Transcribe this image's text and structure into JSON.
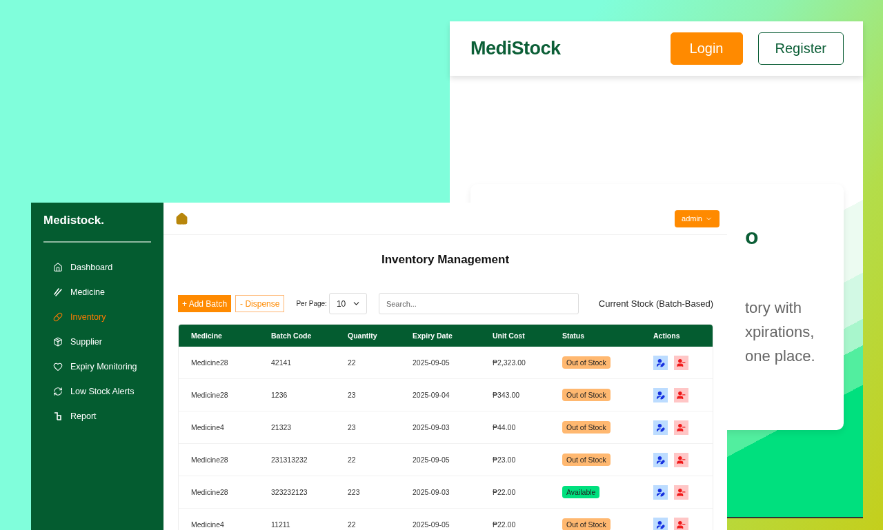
{
  "landing": {
    "logo": "MediStock",
    "buttons": [
      {
        "label": "Login",
        "kind": "primary"
      },
      {
        "label": "Register",
        "kind": "outline"
      }
    ],
    "hero": {
      "heading": "o",
      "lines": [
        "tory with",
        "xpirations,",
        "one place."
      ]
    }
  },
  "app": {
    "brand": "Medistock.",
    "sidebar": {
      "items": [
        {
          "label": "Dashboard",
          "selected": false
        },
        {
          "label": "Medicine",
          "selected": false
        },
        {
          "label": "Inventory",
          "selected": true
        },
        {
          "label": "Supplier",
          "selected": false
        },
        {
          "label": "Expiry Monitoring",
          "selected": false
        },
        {
          "label": "Low Stock Alerts",
          "selected": false
        },
        {
          "label": "Report",
          "selected": false
        }
      ]
    },
    "user_menu": "admin",
    "title": "Inventory Management",
    "toolbar": {
      "add_button": "+ Add Batch",
      "dispense_button": "- Dispense",
      "per_page_label": "Per Page:",
      "per_page_value": "10",
      "search_placeholder": "Search...",
      "section_label": "Current Stock (Batch-Based)"
    },
    "table": {
      "columns": [
        "Medicine",
        "Batch Code",
        "Quantity",
        "Expiry Date",
        "Unit Cost",
        "Status",
        "Actions"
      ],
      "rows": [
        {
          "cells": [
            "Medicine28",
            "42141",
            "22",
            "2025-09-05",
            "₱2,323.00"
          ],
          "status": "Out of Stock",
          "kind": "out"
        },
        {
          "cells": [
            "Medicine28",
            "1236",
            "23",
            "2025-09-04",
            "₱343.00"
          ],
          "status": "Out of Stock",
          "kind": "out"
        },
        {
          "cells": [
            "Medicine4",
            "21323",
            "23",
            "2025-09-03",
            "₱44.00"
          ],
          "status": "Out of Stock",
          "kind": "out"
        },
        {
          "cells": [
            "Medicine28",
            "231313232",
            "22",
            "2025-09-05",
            "₱23.00"
          ],
          "status": "Out of Stock",
          "kind": "out"
        },
        {
          "cells": [
            "Medicine28",
            "323232123",
            "223",
            "2025-09-03",
            "₱22.00"
          ],
          "status": "Available",
          "kind": "available"
        },
        {
          "cells": [
            "Medicine4",
            "11211",
            "22",
            "2025-09-05",
            "₱22.00"
          ],
          "status": "Out of Stock",
          "kind": "out"
        }
      ]
    }
  }
}
